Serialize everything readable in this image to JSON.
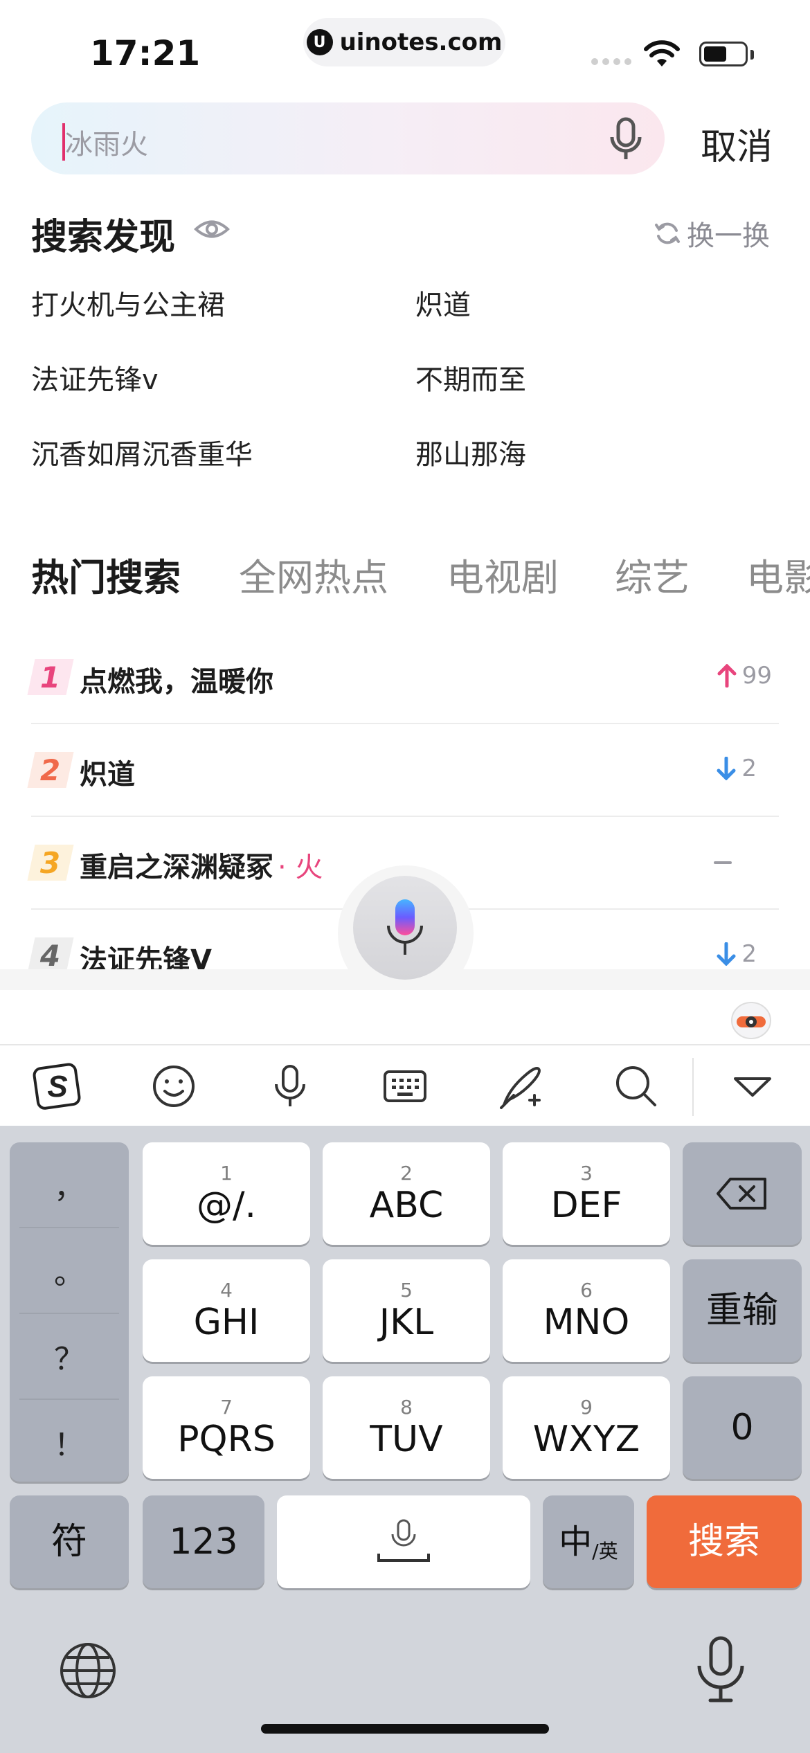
{
  "status": {
    "time": "17:21",
    "url": "uinotes.com"
  },
  "search": {
    "placeholder": "冰雨火",
    "cancel_label": "取消"
  },
  "discover": {
    "title": "搜索发现",
    "refresh_label": "换一换",
    "items": [
      "打火机与公主裙",
      "炽道",
      "法证先锋ⅴ",
      "不期而至",
      "沉香如屑沉香重华",
      "那山那海"
    ]
  },
  "tabs": [
    {
      "label": "热门搜索",
      "active": true
    },
    {
      "label": "全网热点",
      "active": false
    },
    {
      "label": "电视剧",
      "active": false
    },
    {
      "label": "综艺",
      "active": false
    },
    {
      "label": "电影",
      "active": false
    }
  ],
  "hot_list": [
    {
      "rank": "1",
      "title": "点燃我，温暖你",
      "tag": "",
      "trend": "up",
      "change": "99",
      "rank_color": "#e8457d",
      "rank_bg": "#fde6ef"
    },
    {
      "rank": "2",
      "title": "炽道",
      "tag": "",
      "trend": "down",
      "change": "2",
      "rank_color": "#f0694a",
      "rank_bg": "#fdeae3"
    },
    {
      "rank": "3",
      "title": "重启之深渊疑冢",
      "tag": "· 火",
      "trend": "flat",
      "change": "",
      "rank_color": "#f5a623",
      "rank_bg": "#fdf2dc"
    },
    {
      "rank": "4",
      "title": "法证先锋V",
      "tag": "",
      "trend": "down",
      "change": "2",
      "rank_color": "#666666",
      "rank_bg": "#eeeeee"
    }
  ],
  "keyboard": {
    "punctuation": [
      "，",
      "。",
      "？",
      "！"
    ],
    "keys": [
      {
        "num": "1",
        "label": "@/."
      },
      {
        "num": "2",
        "label": "ABC"
      },
      {
        "num": "3",
        "label": "DEF"
      },
      {
        "num": "4",
        "label": "GHI"
      },
      {
        "num": "5",
        "label": "JKL"
      },
      {
        "num": "6",
        "label": "MNO"
      },
      {
        "num": "7",
        "label": "PQRS"
      },
      {
        "num": "8",
        "label": "TUV"
      },
      {
        "num": "9",
        "label": "WXYZ"
      }
    ],
    "retype_label": "重输",
    "zero_label": "0",
    "symbols_label": "符",
    "numbers_label": "123",
    "lang_label": "中",
    "lang_sub": "/英",
    "search_label": "搜索"
  },
  "colors": {
    "accent": "#f06b3b",
    "up": "#e8457d",
    "down": "#3a8ee6"
  }
}
